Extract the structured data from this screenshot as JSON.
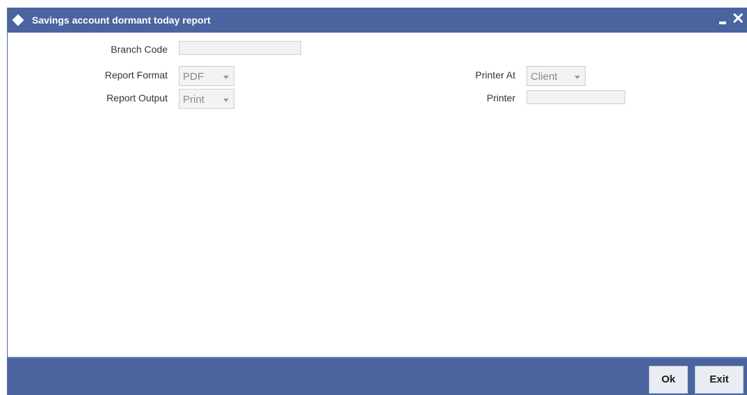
{
  "window": {
    "title": "Savings account dormant today report",
    "icons": {
      "title": "diamond-icon",
      "minimize": "minimize-icon",
      "close": "close-icon"
    },
    "close_glyph": "✕"
  },
  "form": {
    "branch_code": {
      "label": "Branch Code",
      "value": ""
    },
    "report_format": {
      "label": "Report Format",
      "value": "PDF"
    },
    "report_output": {
      "label": "Report Output",
      "value": "Print"
    },
    "printer_at": {
      "label": "Printer At",
      "value": "Client"
    },
    "printer": {
      "label": "Printer",
      "value": ""
    }
  },
  "footer": {
    "ok_label": "Ok",
    "exit_label": "Exit"
  },
  "colors": {
    "titlebar": "#4b64a0",
    "footer": "#4b64a0"
  }
}
